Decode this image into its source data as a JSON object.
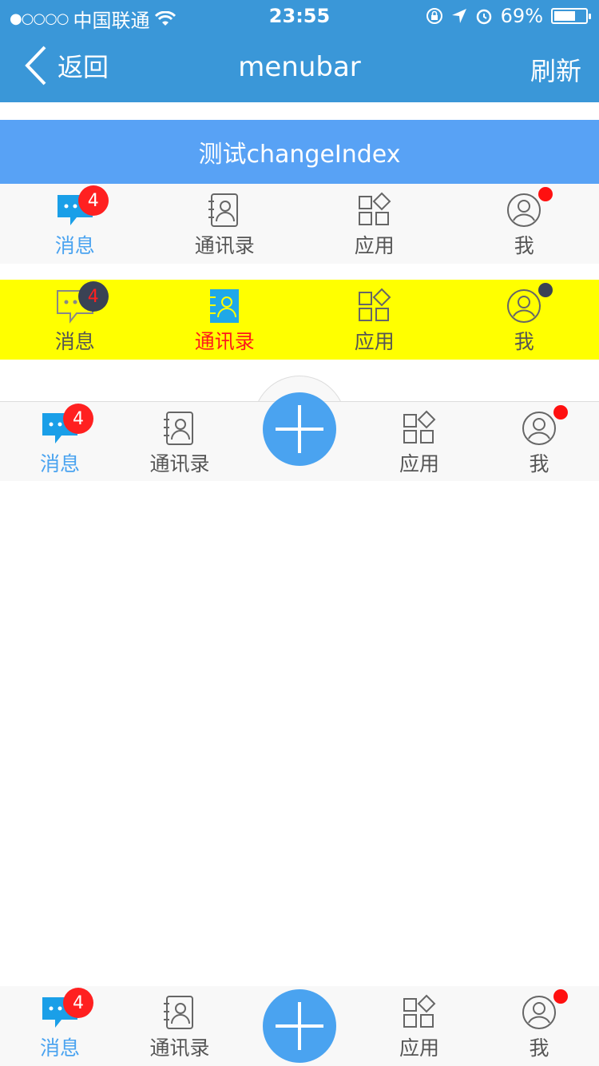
{
  "status_bar": {
    "signal": "●○○○○",
    "carrier": "中国联通",
    "time": "23:55",
    "battery": "69%",
    "battery_level": 0.69
  },
  "nav": {
    "back_label": "返回",
    "title": "menubar",
    "refresh_label": "刷新"
  },
  "test_button": {
    "label": "测试changeIndex"
  },
  "tabs": {
    "messages": "消息",
    "contacts": "通讯录",
    "apps": "应用",
    "me": "我"
  },
  "badges": {
    "message_count": "4"
  },
  "colors": {
    "nav_bg": "#3a97d8",
    "button_bg": "#58a2f5",
    "active_blue": "#4aa3f0",
    "active_red": "#ff1a1a",
    "yellow_bar": "#ffff00",
    "badge_red": "#ff2020",
    "badge_dark": "#3a4254"
  },
  "icons": [
    "chat-bubble-icon",
    "contacts-book-icon",
    "apps-grid-icon",
    "user-avatar-icon",
    "plus-icon",
    "back-chevron-icon"
  ]
}
